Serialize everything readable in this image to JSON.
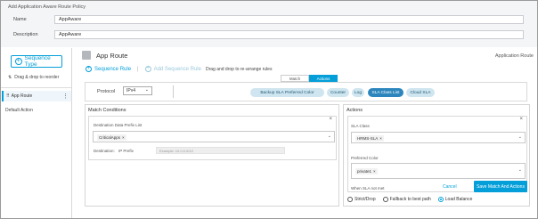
{
  "header": {
    "title": "Add Application Aware Route Policy",
    "name_label": "Name",
    "name_value": "AppAware",
    "description_label": "Description",
    "description_value": "AppAware"
  },
  "sidebar": {
    "sequence_type_label": "Sequence Type",
    "drag_hint": "Drag & drop to reorder",
    "sequence_item": "App Route",
    "default_action": "Default Action"
  },
  "main": {
    "title": "App Route",
    "right_label": "Application Route",
    "sequence_rule_label": "Sequence Rule",
    "add_sequence_rule_label": "Add Sequence Rule",
    "drag_hint": "Drag and drop to re-arrange rules",
    "tabs": [
      "Match",
      "Actions"
    ],
    "protocol_label": "Protocol",
    "protocol_value": "IPv4",
    "action_pills": [
      "Backup SLA Preferred Color",
      "Counter",
      "Log",
      "SLA Class List",
      "Cloud SLA"
    ]
  },
  "match": {
    "title": "Match Conditions",
    "prefix_list_label": "Destination Data Prefix List",
    "prefix_chip": "CriticalApps",
    "destination_label": "Destination:",
    "ip_prefix_label": "IP Prefix",
    "ip_prefix_placeholder": "Example: 10.0.0.0/12"
  },
  "actions": {
    "title": "Actions",
    "sla_class_label": "SLA Class",
    "sla_chip": "HRMS-SLA",
    "preferred_color_label": "Preferred Color",
    "color_chip": "private1",
    "when_not_met_label": "When SLA not met",
    "radio_options": [
      "Strict/Drop",
      "Fallback to best path",
      "Load Balance"
    ]
  },
  "footer": {
    "cancel_label": "Cancel",
    "save_label": "Save Match And Actions"
  },
  "colors": {
    "accent": "#049fd9",
    "pill": "#cfe5f0",
    "pill_active": "#2c86bd"
  }
}
